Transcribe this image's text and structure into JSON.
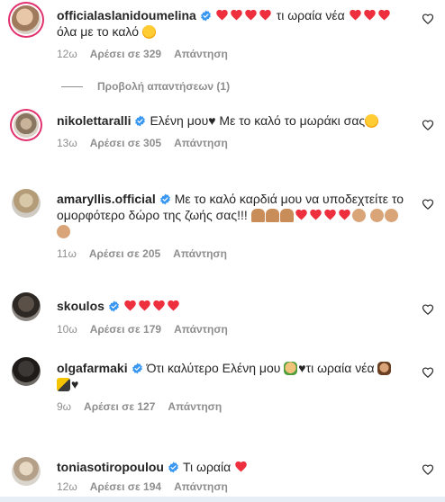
{
  "colors": {
    "heart": "#ed4956",
    "verified": "#3897f0",
    "meta": "#8e8e8e",
    "text": "#262626"
  },
  "view_replies_label": "Προβολή απαντήσεων (1)",
  "comments": [
    {
      "username": "officialaslanidoumelina",
      "text_before": "",
      "text_middle": "τι ωραία νέα",
      "text_line2": "όλα με το καλό",
      "time": "12ω",
      "likes": "Αρέσει σε 329",
      "reply": "Απάντηση"
    },
    {
      "username": "nikolettaralli",
      "text": "Ελένη μου♥ Με το καλό το μωράκι σας",
      "time": "13ω",
      "likes": "Αρέσει σε 305",
      "reply": "Απάντηση"
    },
    {
      "username": "amaryllis.official",
      "text": "Με το καλό καρδιά μου να υποδεχτείτε το ομορφότερο δώρο της ζωής σας!!!",
      "time": "11ω",
      "likes": "Αρέσει σε 205",
      "reply": "Απάντηση"
    },
    {
      "username": "skoulos",
      "time": "10ω",
      "likes": "Αρέσει σε 179",
      "reply": "Απάντηση"
    },
    {
      "username": "olgafarmaki",
      "text_a": "Ότι καλύτερο Ελένη μου",
      "text_b": "♥τι ωραία νέα",
      "text_c": "♥",
      "time": "9ω",
      "likes": "Αρέσει σε 127",
      "reply": "Απάντηση"
    },
    {
      "username": "toniasotiropoulou",
      "text": "Τι ωραία",
      "time": "12ω",
      "likes": "Αρέσει σε 194",
      "reply": "Απάντηση"
    }
  ]
}
